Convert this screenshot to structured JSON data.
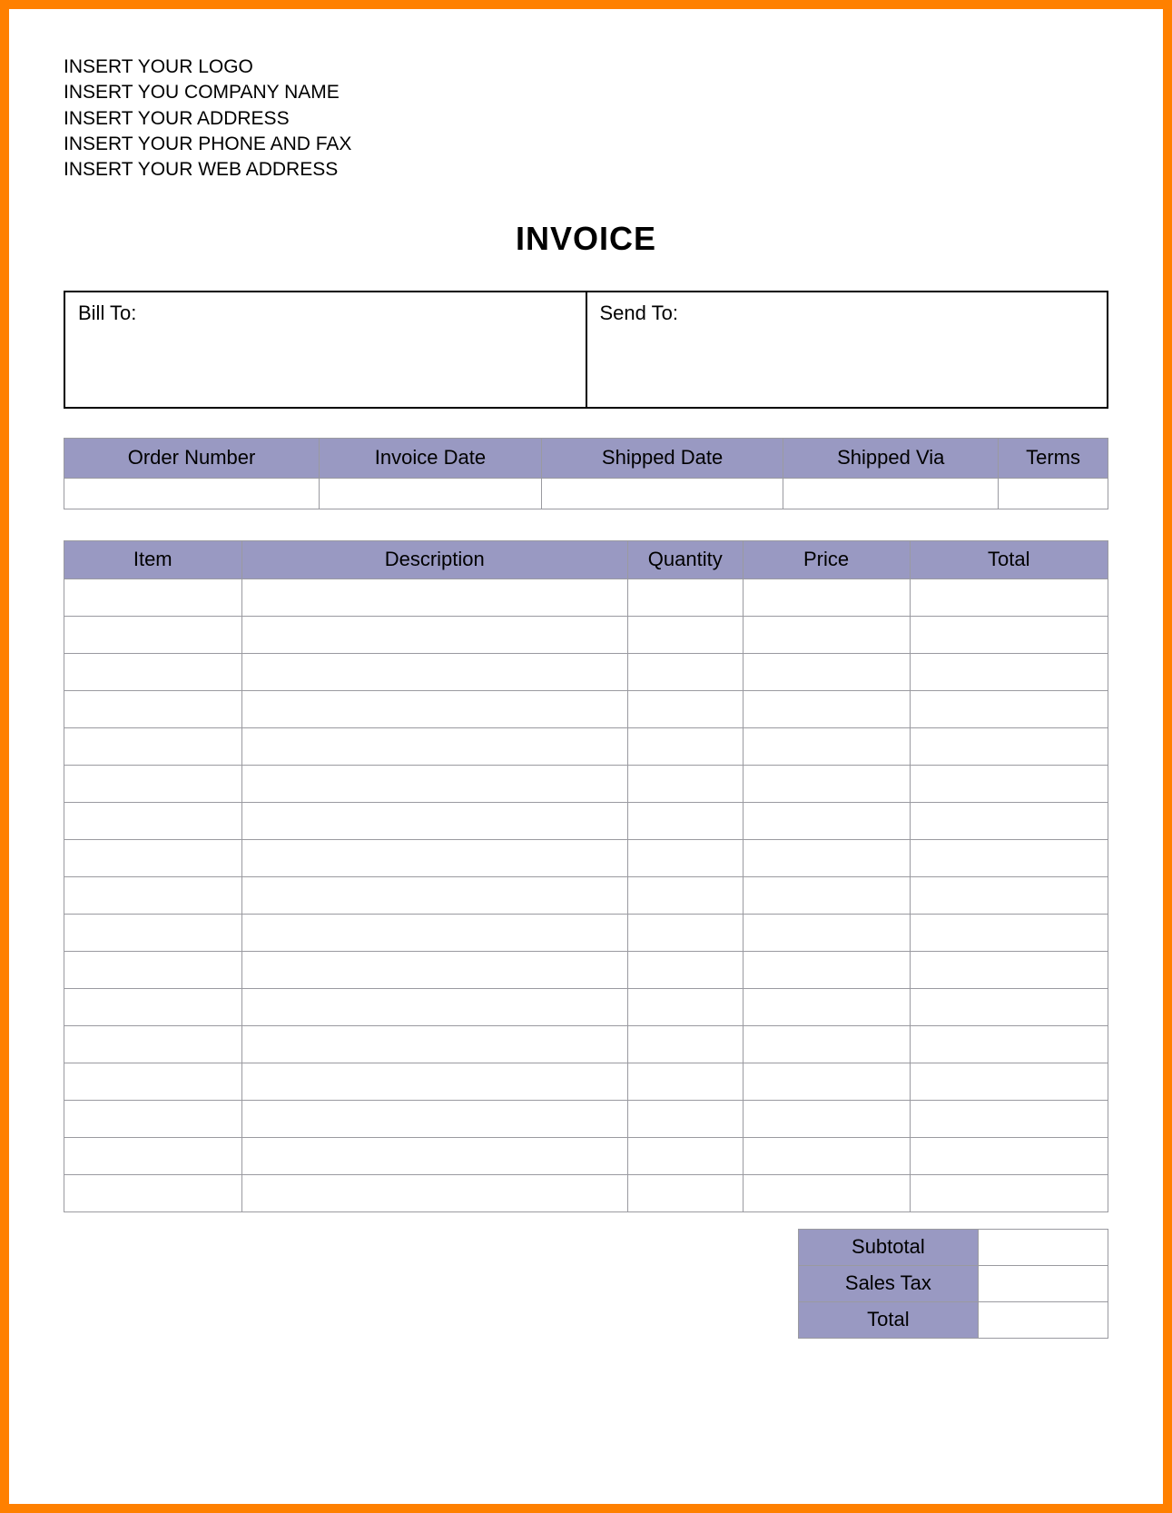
{
  "header": {
    "lines": [
      "INSERT YOUR LOGO",
      "INSERT YOU COMPANY NAME",
      "INSERT YOUR ADDRESS",
      "INSERT YOUR PHONE AND FAX",
      "INSERT YOUR WEB ADDRESS"
    ]
  },
  "title": "INVOICE",
  "addresses": {
    "bill_to_label": "Bill To:",
    "send_to_label": "Send To:"
  },
  "order_table": {
    "headers": [
      "Order Number",
      "Invoice Date",
      "Shipped Date",
      "Shipped Via",
      "Terms"
    ],
    "row": [
      "",
      "",
      "",
      "",
      ""
    ]
  },
  "items_table": {
    "headers": [
      "Item",
      "Description",
      "Quantity",
      "Price",
      "Total"
    ],
    "row_count": 17
  },
  "totals": {
    "labels": [
      "Subtotal",
      "Sales Tax",
      "Total"
    ],
    "values": [
      "",
      "",
      ""
    ]
  },
  "colors": {
    "border": "#ff8000",
    "header_bg": "#9999c2",
    "cell_border": "#9a9aa0"
  }
}
